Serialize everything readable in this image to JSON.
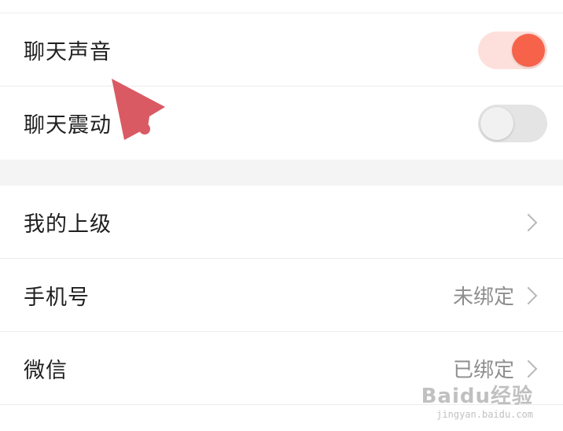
{
  "settings": {
    "chat_sound": {
      "label": "聊天声音",
      "enabled": true
    },
    "chat_vibration": {
      "label": "聊天震动",
      "enabled": false
    }
  },
  "account": {
    "superior": {
      "label": "我的上级"
    },
    "phone": {
      "label": "手机号",
      "value": "未绑定"
    },
    "wechat": {
      "label": "微信",
      "value": "已绑定"
    }
  },
  "colors": {
    "accent": "#f6634a",
    "toggle_on_track": "#fde0dc",
    "toggle_off_track": "#e4e4e4",
    "arrow": "#d95a63"
  },
  "icons": {
    "row_chevron": "chevron-right-icon",
    "pointer": "red-arrow-annotation"
  },
  "watermark": {
    "logo": "Baidu经验",
    "url": "jingyan.baidu.com"
  }
}
